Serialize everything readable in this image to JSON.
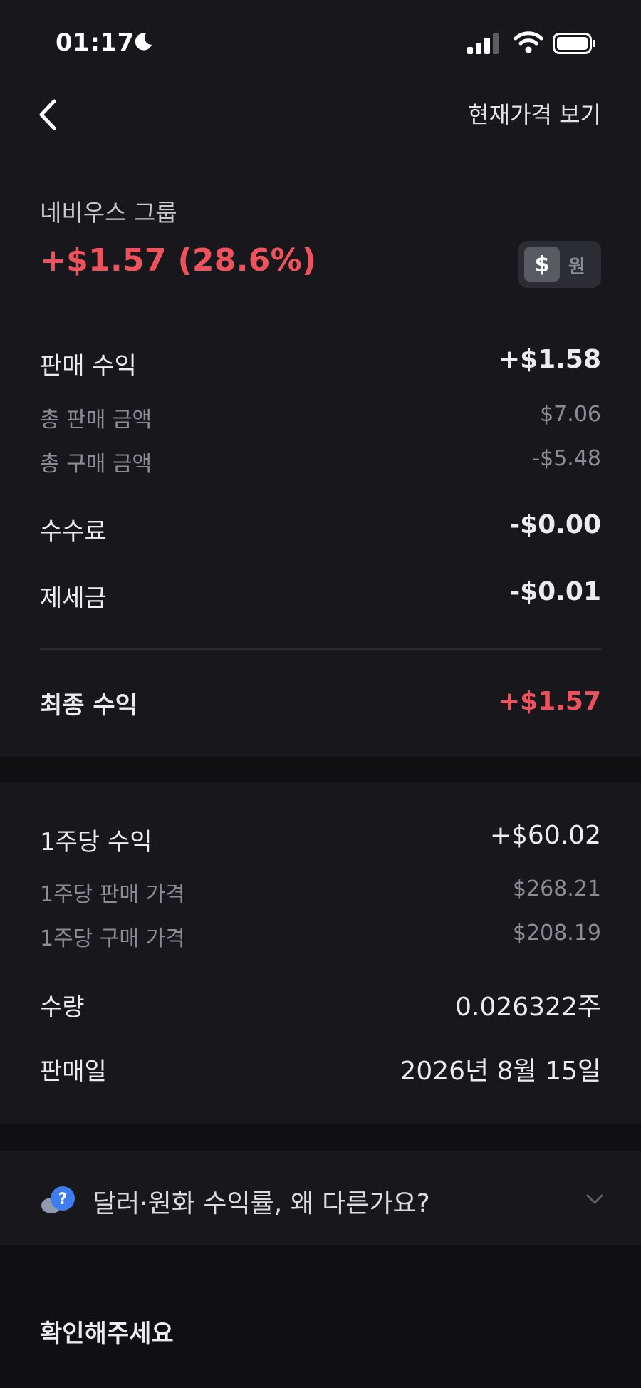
{
  "status_bar": {
    "time": "01:17"
  },
  "nav": {
    "action_label": "현재가격 보기"
  },
  "stock": {
    "name": "네비우스 그룹",
    "profit_summary": "+$1.57 (28.6%)",
    "currency_toggle": {
      "dollar_symbol": "$",
      "won_label": "원",
      "selected": "dollar"
    }
  },
  "sales": {
    "profit_label": "판매 수익",
    "profit_value": "+$1.58",
    "total_sale_label": "총 판매 금액",
    "total_sale_value": "$7.06",
    "total_buy_label": "총 구매 금액",
    "total_buy_value": "-$5.48",
    "fee_label": "수수료",
    "fee_value": "-$0.00",
    "tax_label": "제세금",
    "tax_value": "-$0.01",
    "final_label": "최종 수익",
    "final_value": "+$1.57"
  },
  "per_share": {
    "profit_label": "1주당 수익",
    "profit_value": "+$60.02",
    "sale_price_label": "1주당 판매 가격",
    "sale_price_value": "$268.21",
    "buy_price_label": "1주당 구매 가격",
    "buy_price_value": "$208.19",
    "quantity_label": "수량",
    "quantity_value": "0.026322주",
    "sale_date_label": "판매일",
    "sale_date_value": "2026년 8월 15일"
  },
  "faq": {
    "question": "달러·원화 수익률, 왜 다른가요?"
  },
  "confirm": {
    "title": "확인해주세요"
  },
  "colors": {
    "profit_red": "#F0525D",
    "background": "#17171C",
    "muted": "#8C8C95"
  }
}
